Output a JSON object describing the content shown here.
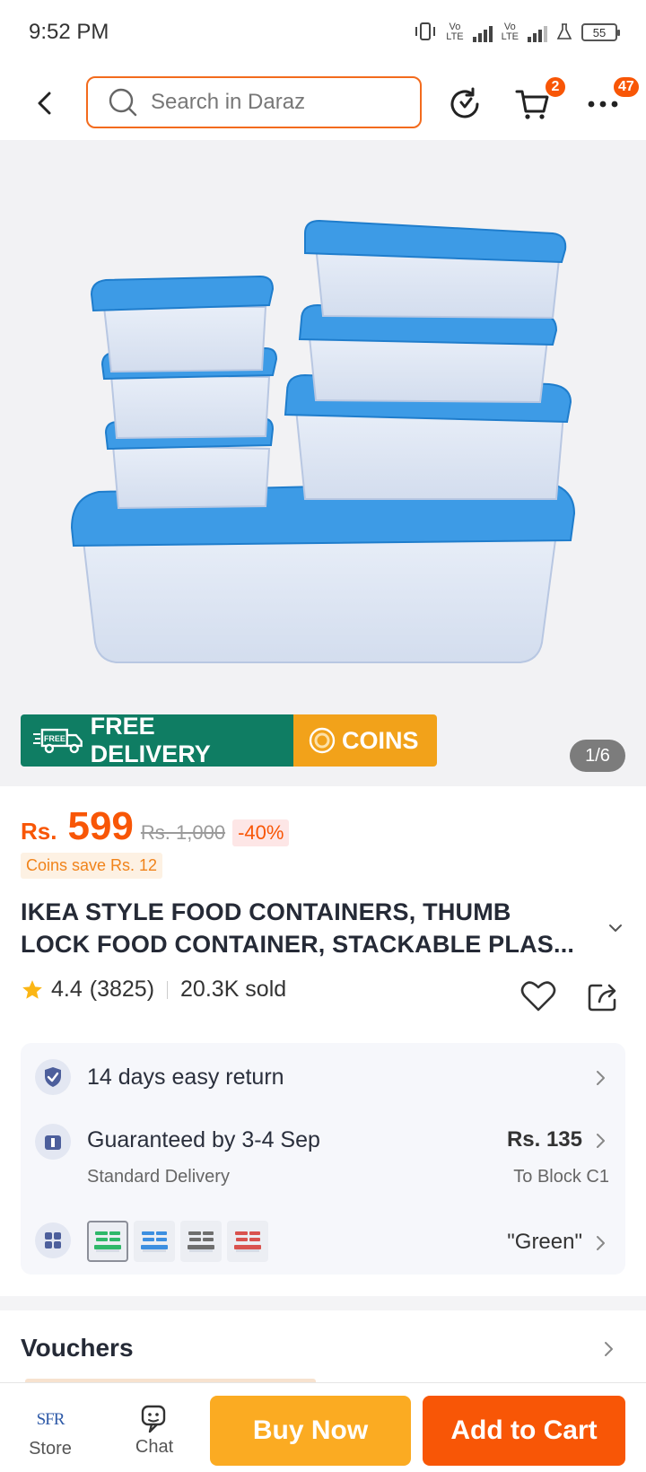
{
  "status_bar": {
    "time": "9:52 PM",
    "battery": "55"
  },
  "header": {
    "search_placeholder": "Search in Daraz",
    "cart_badge": "2",
    "more_badge": "47"
  },
  "gallery": {
    "promo_free_delivery": "FREE DELIVERY",
    "promo_coins": "COINS",
    "page_indicator": "1/6",
    "truck_label": "FREE"
  },
  "product": {
    "currency": "Rs.",
    "price": "599",
    "original_price": "Rs. 1,000",
    "discount": "-40%",
    "coins_save": "Coins save Rs. 12",
    "title_line1": "IKEA STYLE FOOD CONTAINERS, THUMB",
    "title_line2": "LOCK FOOD CONTAINER, STACKABLE PLAS...",
    "rating": "4.4",
    "review_count": "(3825)",
    "sold": "20.3K sold"
  },
  "info": {
    "return_text": "14 days easy return",
    "delivery_text": "Guaranteed by 3-4 Sep",
    "delivery_type": "Standard Delivery",
    "shipping_fee": "Rs. 135",
    "destination": "To Block C1",
    "selected_variant": "\"Green\"",
    "swatch_colors": [
      "#2fb86a",
      "#3d8fe0",
      "#6e6e6e",
      "#d9534f"
    ]
  },
  "sections": {
    "vouchers_title": "Vouchers"
  },
  "bottom_bar": {
    "store_logo": "SFR",
    "store_label": "Store",
    "chat_label": "Chat",
    "buy_now": "Buy Now",
    "add_to_cart": "Add to Cart"
  },
  "colors": {
    "accent": "#f85606",
    "buy_now": "#fbab22",
    "free_delivery": "#0f7d63",
    "coins": "#f2a21a"
  }
}
